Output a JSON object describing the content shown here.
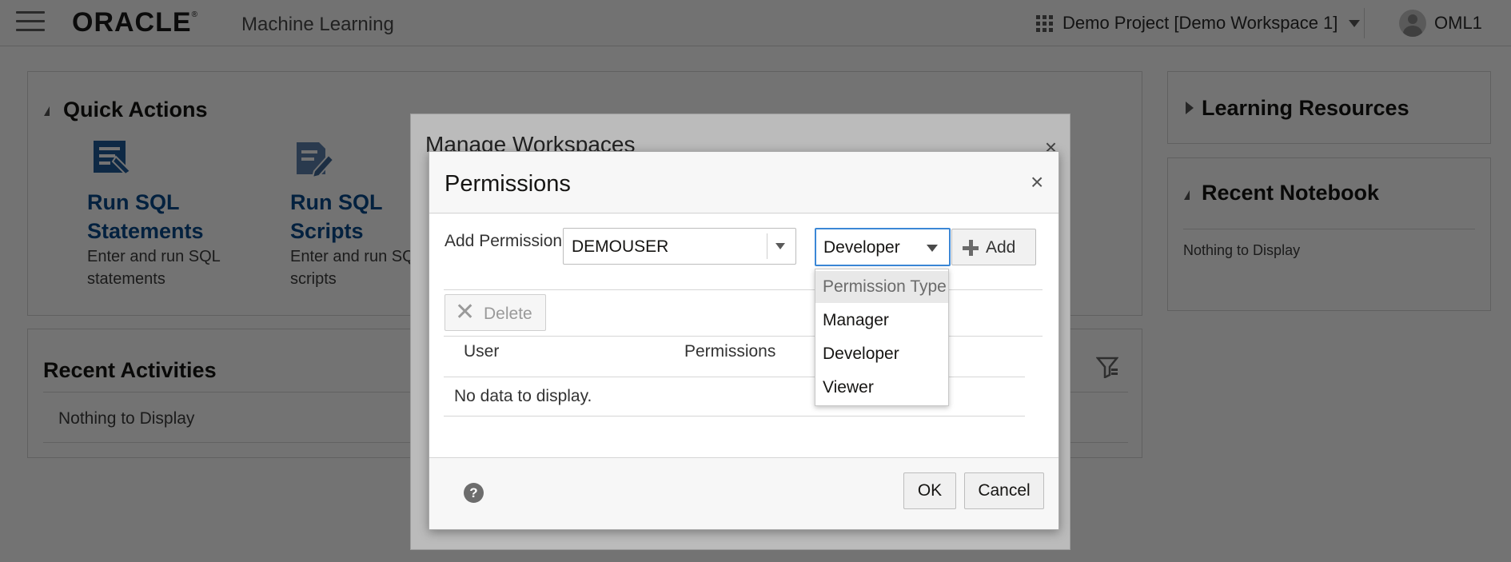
{
  "header": {
    "brand": "ORACLE",
    "brand_mark": "®",
    "app_name": "Machine Learning",
    "project": "Demo Project [Demo Workspace 1]",
    "user": "OML1"
  },
  "quick_actions": {
    "title": "Quick Actions",
    "items": [
      {
        "title": "Run SQL Statements",
        "desc": "Enter and run SQL statements"
      },
      {
        "title": "Run SQL Scripts",
        "desc": "Enter and run SQL scripts"
      }
    ]
  },
  "recent_activities": {
    "title": "Recent Activities",
    "empty": "Nothing to Display"
  },
  "learning_resources": {
    "title": "Learning Resources"
  },
  "recent_notebook": {
    "title": "Recent Notebook",
    "empty": "Nothing to Display"
  },
  "manage_dialog": {
    "title": "Manage Workspaces",
    "close": "×"
  },
  "permissions_dialog": {
    "title": "Permissions",
    "close": "×",
    "add_label": "Add Permission:",
    "user_value": "DEMOUSER",
    "type_value": "Developer",
    "add_button": "Add",
    "delete_button": "Delete",
    "columns": [
      "User",
      "Permissions"
    ],
    "empty": "No data to display.",
    "help": "?",
    "ok": "OK",
    "cancel": "Cancel",
    "type_options": [
      "Permission Type",
      "Manager",
      "Developer",
      "Viewer"
    ]
  },
  "colors": {
    "link_blue": "#0a4b8c",
    "focus_blue": "#3b87d6",
    "icon_blue": "#1f5c99"
  },
  "icons": [
    "hamburger-icon",
    "grid-icon",
    "avatar-icon",
    "sql-statements-icon",
    "sql-scripts-icon",
    "filter-icon",
    "help-icon",
    "plus-icon",
    "delete-x-icon",
    "chevron-down-icon"
  ]
}
